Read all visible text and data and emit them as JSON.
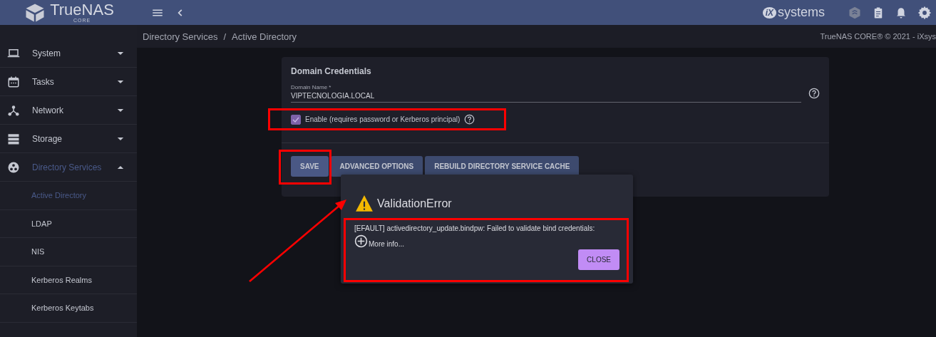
{
  "header": {
    "logo": {
      "name": "TrueNAS",
      "edition": "CORE"
    },
    "vendor_logo": {
      "mark": "iX",
      "name": "systems"
    }
  },
  "sidebar": {
    "items": [
      {
        "label": "System",
        "expanded": false,
        "selected": false
      },
      {
        "label": "Tasks",
        "expanded": false,
        "selected": false
      },
      {
        "label": "Network",
        "expanded": false,
        "selected": false
      },
      {
        "label": "Storage",
        "expanded": false,
        "selected": false
      },
      {
        "label": "Directory Services",
        "expanded": true,
        "selected": true,
        "children": [
          {
            "label": "Active Directory",
            "selected": true
          },
          {
            "label": "LDAP",
            "selected": false
          },
          {
            "label": "NIS",
            "selected": false
          },
          {
            "label": "Kerberos Realms",
            "selected": false
          },
          {
            "label": "Kerberos Keytabs",
            "selected": false
          }
        ]
      }
    ]
  },
  "breadcrumb": {
    "items": [
      "Directory Services",
      "Active Directory"
    ],
    "separator": "/"
  },
  "copyright": "TrueNAS CORE® © 2021 - iXsys",
  "form": {
    "section_title": "Domain Credentials",
    "domain_name": {
      "label": "Domain Name *",
      "value": "VIPTECNOLOGIA.LOCAL"
    },
    "enable": {
      "label": "Enable (requires password or Kerberos principal)",
      "checked": true
    },
    "buttons": [
      "SAVE",
      "ADVANCED OPTIONS",
      "REBUILD DIRECTORY SERVICE CACHE"
    ]
  },
  "dialog": {
    "title": "ValidationError",
    "message": "[EFAULT] activedirectory_update.bindpw: Failed to validate bind credentials:",
    "more_info": "More info...",
    "button": "CLOSE"
  }
}
